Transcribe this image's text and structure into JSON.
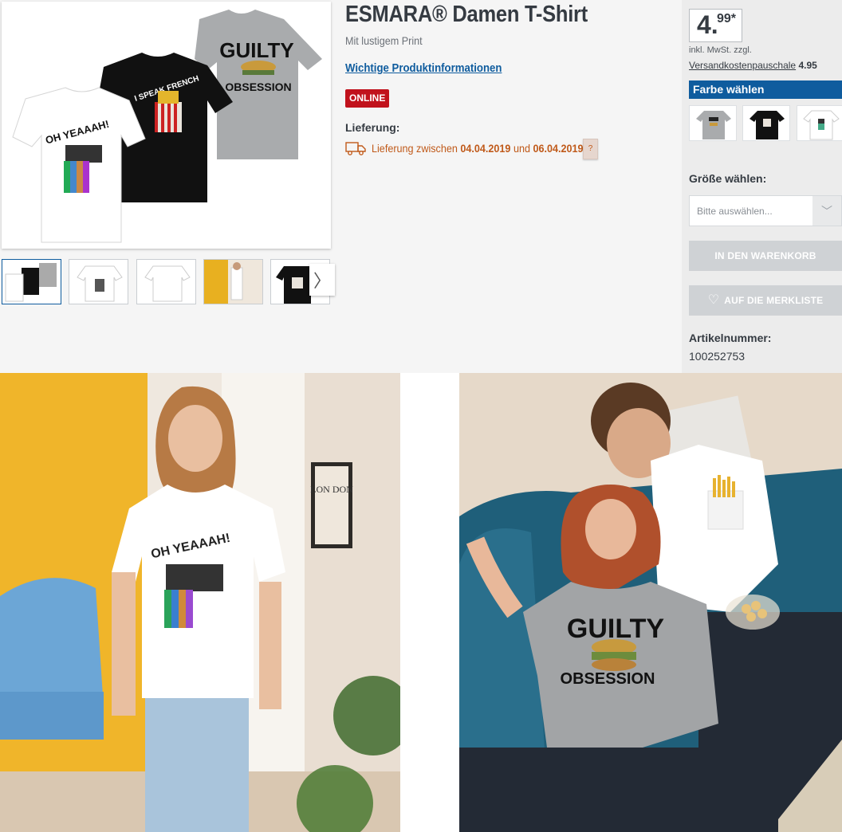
{
  "product": {
    "title": "ESMARA® Damen T-Shirt",
    "subtitle": "Mit lustigem Print",
    "info_link": "Wichtige Produktinformationen",
    "badge": "ONLINE",
    "delivery_label": "Lieferung:",
    "delivery_prefix": "Lieferung zwischen",
    "delivery_from": "04.04.2019",
    "delivery_and": "und",
    "delivery_to": "06.04.2019.",
    "help": "?"
  },
  "gallery": {
    "thumb_count": 5,
    "next": "〉",
    "main_prints": [
      "OH YEAAAH!",
      "I SPEAK FRENCH",
      "GUILTY",
      "OBSESSION"
    ]
  },
  "price": {
    "integer": "4.",
    "decimal": "99*",
    "vat": "inkl. MwSt. zzgl.",
    "shipping_link": "Versandkostenpauschale",
    "shipping_value": "4.95"
  },
  "options": {
    "color_header": "Farbe wählen",
    "size_label": "Größe wählen:",
    "size_placeholder": "Bitte auswählen...",
    "size_arrow": "﹀"
  },
  "actions": {
    "cart": "IN DEN WARENKORB",
    "wishlist": "AUF DIE MERKLISTE",
    "heart": "♡"
  },
  "article": {
    "label": "Artikelnummer:",
    "number": "100252753"
  },
  "photos": {
    "left_print": "OH YEAAAH!",
    "left_poster": "LON DON",
    "right_print_top": "GUILTY",
    "right_print_bottom": "OBSESSION"
  },
  "colors": {
    "accent": "#0f5c9e",
    "badge": "#c1121c",
    "delivery": "#c05a1a",
    "button_disabled": "#cfd2d5"
  }
}
